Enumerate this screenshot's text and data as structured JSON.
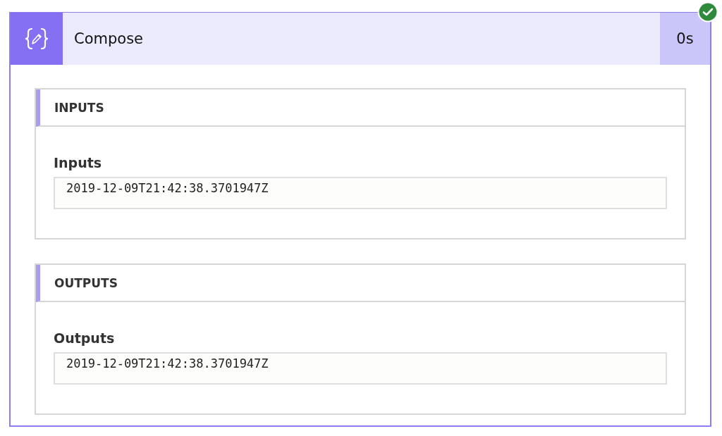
{
  "action": {
    "title": "Compose",
    "duration": "0s",
    "succeeded": true
  },
  "sections": [
    {
      "heading": "INPUTS",
      "label": "Inputs",
      "value": "2019-12-09T21:42:38.3701947Z"
    },
    {
      "heading": "OUTPUTS",
      "label": "Outputs",
      "value": "2019-12-09T21:42:38.3701947Z"
    }
  ]
}
